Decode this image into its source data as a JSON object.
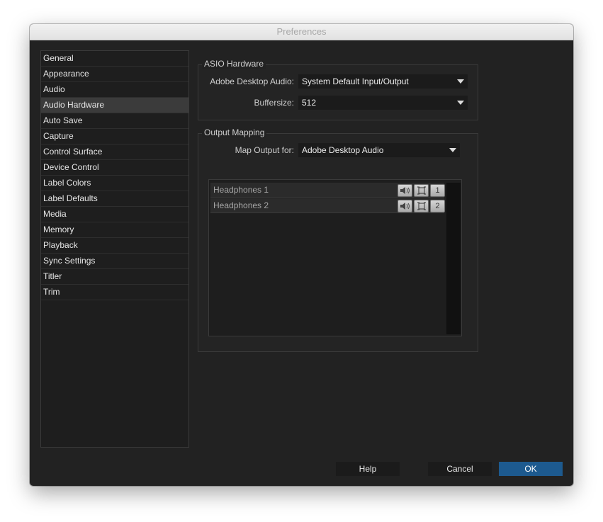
{
  "window": {
    "title": "Preferences"
  },
  "sidebar": {
    "items": [
      {
        "label": "General"
      },
      {
        "label": "Appearance"
      },
      {
        "label": "Audio"
      },
      {
        "label": "Audio Hardware"
      },
      {
        "label": "Auto Save"
      },
      {
        "label": "Capture"
      },
      {
        "label": "Control Surface"
      },
      {
        "label": "Device Control"
      },
      {
        "label": "Label Colors"
      },
      {
        "label": "Label Defaults"
      },
      {
        "label": "Media"
      },
      {
        "label": "Memory"
      },
      {
        "label": "Playback"
      },
      {
        "label": "Sync Settings"
      },
      {
        "label": "Titler"
      },
      {
        "label": "Trim"
      }
    ],
    "selected": "Audio Hardware"
  },
  "asio": {
    "title": "ASIO Hardware",
    "device_label": "Adobe Desktop Audio:",
    "device_value": "System Default Input/Output",
    "buffer_label": "Buffersize:",
    "buffer_value": "512"
  },
  "output_mapping": {
    "title": "Output Mapping",
    "map_label": "Map Output for:",
    "map_value": "Adobe Desktop Audio",
    "rows": [
      {
        "name": "Headphones 1",
        "channel": "1"
      },
      {
        "name": "Headphones 2",
        "channel": "2"
      }
    ]
  },
  "buttons": {
    "help": "Help",
    "cancel": "Cancel",
    "ok": "OK"
  },
  "colors": {
    "accent": "#1d5a8f",
    "window_bg": "#222222"
  }
}
